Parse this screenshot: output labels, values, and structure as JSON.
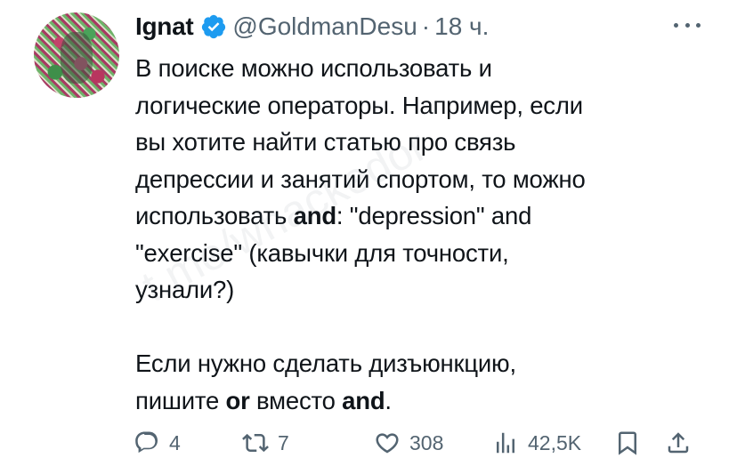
{
  "tweet": {
    "author_name": "Ignat",
    "handle": "@GoldmanDesu",
    "separator": "·",
    "time": "18 ч.",
    "body_lines": [
      [
        {
          "text": "В поиске можно использовать и"
        }
      ],
      [
        {
          "text": "логические операторы. Например, если"
        }
      ],
      [
        {
          "text": "вы хотите найти статью про связь"
        }
      ],
      [
        {
          "text": "депрессии и занятий спортом, то можно"
        }
      ],
      [
        {
          "text": "использовать "
        },
        {
          "text": "and",
          "bold": true
        },
        {
          "text": ": \"depression\" and"
        }
      ],
      [
        {
          "text": "\"exercise\" (кавычки для точности,"
        }
      ],
      [
        {
          "text": "узнали?)"
        }
      ],
      [],
      [
        {
          "text": "Если нужно сделать дизъюнкцию,"
        }
      ],
      [
        {
          "text": "пишите "
        },
        {
          "text": "or",
          "bold": true
        },
        {
          "text": " вместо "
        },
        {
          "text": "and",
          "bold": true
        },
        {
          "text": "."
        }
      ]
    ],
    "watermark": "t.me/whackedor",
    "actions": {
      "replies": "4",
      "retweets": "7",
      "likes": "308",
      "views": "42,5K"
    }
  },
  "icons": {
    "verified": "verified-badge-icon",
    "more": "more-options-icon",
    "reply": "reply-icon",
    "retweet": "retweet-icon",
    "like": "heart-icon",
    "views": "views-chart-icon",
    "bookmark": "bookmark-icon",
    "share": "share-icon"
  },
  "colors": {
    "text": "#0f1419",
    "secondary": "#536471",
    "verified": "#1d9bf0"
  }
}
